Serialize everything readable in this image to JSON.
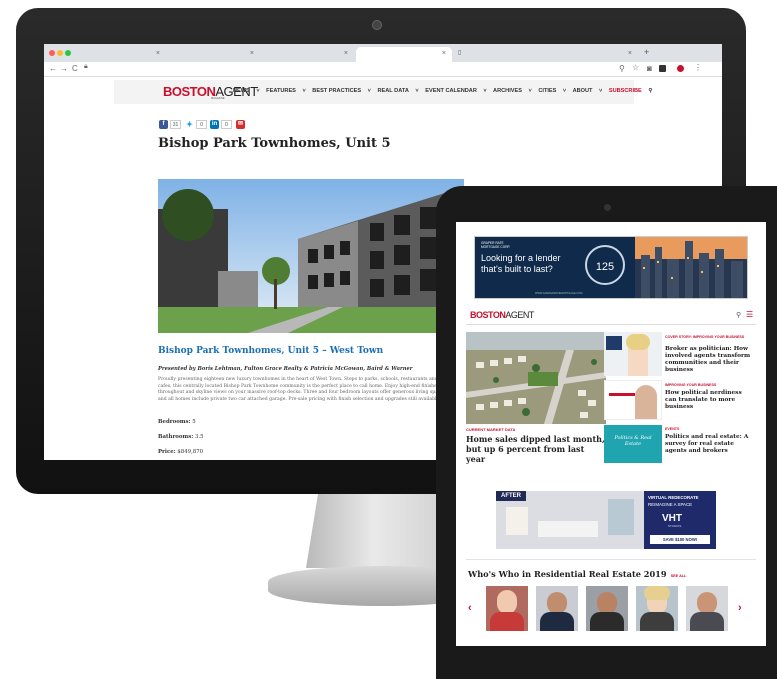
{
  "desktop": {
    "browser": {
      "tabs": [
        {
          "close": "×"
        },
        {
          "close": "×"
        },
        {
          "close": "×"
        },
        {
          "close": "×"
        },
        {
          "close": "×"
        }
      ],
      "new_tab": "+",
      "nav_icons": {
        "back": "←",
        "forward": "→",
        "reload": "C"
      },
      "toolbar_icons": [
        "search-icon",
        "star-icon",
        "camera-icon",
        "extension-icon",
        "profile-icon",
        "menu-icon"
      ]
    },
    "site": {
      "logo_boston": "BOSTON",
      "logo_agent": "AGENT",
      "logo_tag": "MAGAZINE",
      "nav": [
        "NEWS",
        "FEATURES",
        "BEST PRACTICES",
        "REAL DATA",
        "EVENT CALENDAR",
        "ARCHIVES",
        "CITIES",
        "ABOUT"
      ],
      "subscribe": "SUBSCRIBE"
    },
    "share": [
      {
        "network": "facebook",
        "glyph": "f",
        "count": "31"
      },
      {
        "network": "twitter",
        "glyph": "t",
        "count": "0"
      },
      {
        "network": "linkedin",
        "glyph": "in",
        "count": "0"
      },
      {
        "network": "email",
        "glyph": "✉",
        "count": ""
      }
    ],
    "article": {
      "title": "Bishop Park Townhomes, Unit 5",
      "subtitle": "Bishop Park Townhomes, Unit 5 – West Town",
      "presented_by": "Presented by Boris Lehtman, Fulton Grace Realty & Patricia McGowan, Baird & Warner",
      "body": "Proudly presenting eighteen new luxury townhomes in the heart of West Town. Steps to parks, schools, restaurants and cafes, this centrally located Bishop Park Townhome community is the perfect place to call home. Enjoy high-end finishes throughout and skyline views on your massive roof-top decks. Three and four bedroom layouts offer generous living space and all homes include private two car attached garage. Pre-sale pricing with finish selection and upgrades still available.",
      "bedrooms_label": "Bedrooms:",
      "bedrooms": "5",
      "bathrooms_label": "Bathrooms:",
      "bathrooms": "3.5",
      "price_label": "Price:",
      "price": "$849,870"
    }
  },
  "tablet": {
    "ad_top": {
      "brand": "GRAPER RATE MORTGAGE CORP.",
      "headline": "Looking for a lender that's built to last?",
      "seal": "125",
      "url": "WWW.GRAPERRATEMORTGAGE.COM"
    },
    "logo_boston": "BOSTON",
    "logo_agent": "AGENT",
    "menu_icon": "☰",
    "search_icon": "⚲",
    "main_story": {
      "category": "CURRENT MARKET DATA",
      "title": "Home sales dipped last month, but up 6 percent from last year"
    },
    "side_stories": [
      {
        "category": "COVER STORY: IMPROVING YOUR BUSINESS",
        "title": "Broker as politician: How involved agents transform communities and their business"
      },
      {
        "category": "IMPROVING YOUR BUSINESS",
        "title": "How political nerdiness can translate to more business"
      },
      {
        "category": "EVENTS",
        "title": "Politics and real estate: A survey for real estate agents and brokers",
        "thumb_text": "Politics & Real Estate"
      }
    ],
    "ad_bottom": {
      "after": "AFTER",
      "headline": "VIRTUAL REDECORATE",
      "sub": "REIMAGINE A SPACE",
      "brand": "VHT",
      "brand_sub": "STUDIOS",
      "cta": "SAVE $100 NOW!"
    },
    "whos_who": {
      "title": "Who's Who in Residential Real Estate 2019",
      "see_all": "SEE ALL",
      "prev": "‹",
      "next": "›"
    }
  },
  "colors": {
    "accent": "#c8102e",
    "link_blue": "#1a6fb5",
    "teal": "#1fa4b0",
    "bezel": "#1a1a1a"
  }
}
